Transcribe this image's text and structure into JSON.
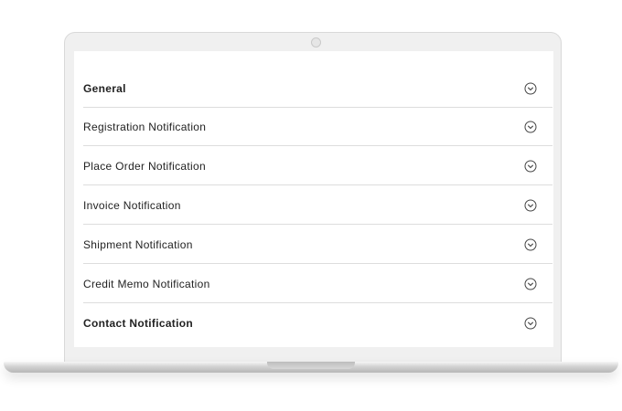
{
  "accordion": {
    "items": [
      {
        "label": "General",
        "bold": true,
        "icon": "chevron-down-circle-icon"
      },
      {
        "label": "Registration Notification",
        "bold": false,
        "icon": "chevron-down-circle-icon"
      },
      {
        "label": "Place Order Notification",
        "bold": false,
        "icon": "chevron-down-circle-icon"
      },
      {
        "label": "Invoice Notification",
        "bold": false,
        "icon": "chevron-down-circle-icon"
      },
      {
        "label": "Shipment Notification",
        "bold": false,
        "icon": "chevron-down-circle-icon"
      },
      {
        "label": "Credit Memo Notification",
        "bold": false,
        "icon": "chevron-down-circle-icon"
      },
      {
        "label": "Contact Notification",
        "bold": true,
        "icon": "chevron-down-circle-icon"
      }
    ]
  },
  "colors": {
    "text": "#222222",
    "divider": "#dddddd",
    "laptop_bezel": "#f0f0f0",
    "icon": "#444444"
  }
}
